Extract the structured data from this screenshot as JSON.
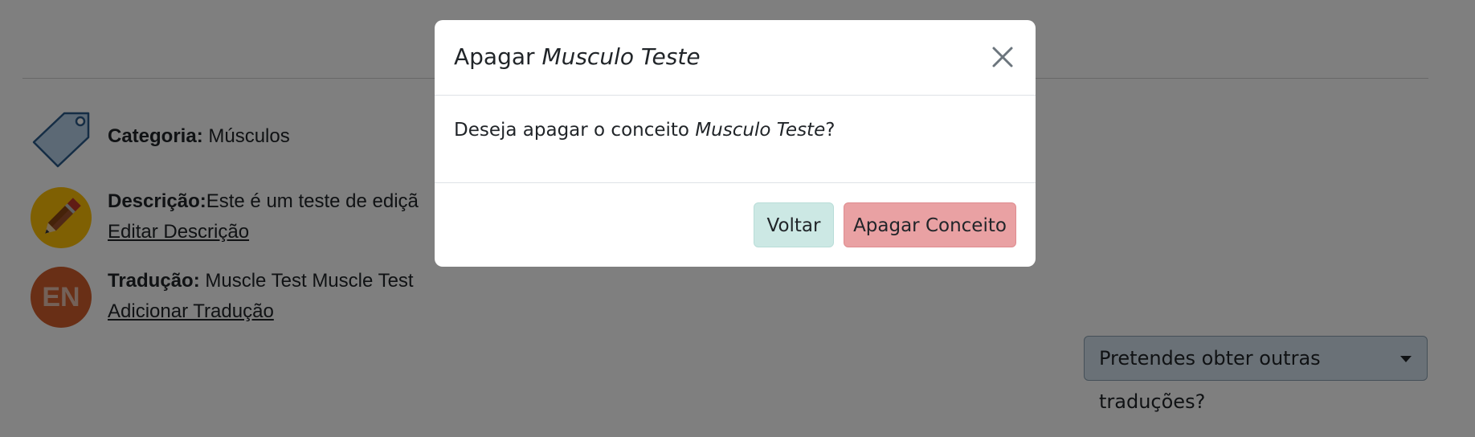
{
  "concept": {
    "category_label": "Categoria:",
    "category_value": "Músculos",
    "description_label": "Descrição:",
    "description_value": "Este é um teste de ediçã",
    "edit_description_link": "Editar Descrição",
    "translation_label": "Tradução:",
    "translation_value": "Muscle Test Muscle Test",
    "translation_badge": "EN",
    "add_translation_link": "Adicionar Tradução"
  },
  "translations_dropdown": {
    "label": "Pretendes obter outras traduções?"
  },
  "modal": {
    "title_prefix": "Apagar",
    "title_concept": "Musculo Teste",
    "body_prefix": "Deseja apagar o conceito",
    "body_concept": "Musculo Teste",
    "body_suffix": "?",
    "back_button": "Voltar",
    "delete_button": "Apagar Conceito"
  },
  "icons": {
    "category": "tag-icon",
    "description": "pencil-icon",
    "translation": "language-en-icon",
    "close": "close-icon",
    "dropdown": "caret-down-icon"
  },
  "colors": {
    "back_button": "#cce8e4",
    "delete_button": "#e9a1a3",
    "dropdown_bg": "#d5e3ee",
    "pencil_circle": "#ffc107",
    "en_circle": "#d35f2c",
    "backdrop": "rgba(0,0,0,0.5)"
  }
}
